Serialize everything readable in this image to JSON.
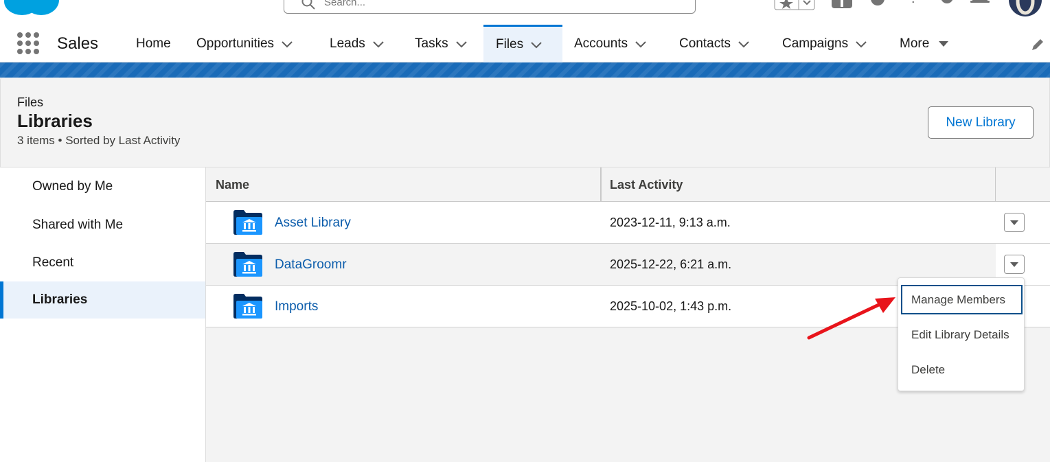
{
  "header": {
    "search_placeholder": "Search..."
  },
  "nav": {
    "app_name": "Sales",
    "items": [
      {
        "label": "Home",
        "has_menu": false
      },
      {
        "label": "Opportunities",
        "has_menu": true
      },
      {
        "label": "Leads",
        "has_menu": true
      },
      {
        "label": "Tasks",
        "has_menu": true
      },
      {
        "label": "Files",
        "has_menu": true,
        "active": true
      },
      {
        "label": "Accounts",
        "has_menu": true
      },
      {
        "label": "Contacts",
        "has_menu": true
      },
      {
        "label": "Campaigns",
        "has_menu": true
      },
      {
        "label": "More",
        "has_menu": true
      }
    ]
  },
  "page_header": {
    "object": "Files",
    "title": "Libraries",
    "meta": "3 items • Sorted by Last Activity",
    "new_button": "New Library"
  },
  "sidebar": {
    "items": [
      {
        "label": "Owned by Me"
      },
      {
        "label": "Shared with Me"
      },
      {
        "label": "Recent"
      },
      {
        "label": "Libraries",
        "active": true
      }
    ]
  },
  "table": {
    "columns": [
      "Name",
      "Last Activity"
    ],
    "rows": [
      {
        "name": "Asset Library",
        "last_activity": "2023-12-11, 9:13 a.m."
      },
      {
        "name": "DataGroomr",
        "last_activity": "2025-12-22, 6:21 a.m."
      },
      {
        "name": "Imports",
        "last_activity": "2025-10-02, 1:43 p.m."
      }
    ]
  },
  "dropdown": {
    "items": [
      "Manage Members",
      "Edit Library Details",
      "Delete"
    ],
    "focused": "Manage Members"
  },
  "colors": {
    "brand": "#0176d3",
    "link": "#0b5cab",
    "annotation_arrow": "#e8141b"
  }
}
